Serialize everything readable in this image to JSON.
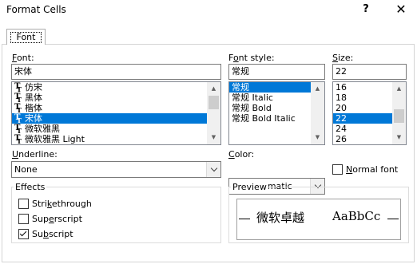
{
  "window": {
    "title": "Format Cells",
    "help_glyph": "?",
    "close_glyph": "✕"
  },
  "tabs": [
    {
      "label": "Font"
    }
  ],
  "font": {
    "label_prefix": "",
    "label_accel": "F",
    "label_rest": "ont:",
    "value": "宋体",
    "items": [
      "仿宋",
      "黑体",
      "楷体",
      "宋体",
      "微软雅黑",
      "微软雅黑 Light"
    ],
    "selected_index": 3
  },
  "font_style": {
    "label_prefix": "F",
    "label_accel": "o",
    "label_rest": "nt style:",
    "value": "常规",
    "items": [
      "常规",
      "常规 Italic",
      "常规 Bold",
      "常规 Bold Italic"
    ],
    "selected_index": 0
  },
  "size": {
    "label_prefix": "",
    "label_accel": "S",
    "label_rest": "ize:",
    "value": "22",
    "items": [
      "16",
      "18",
      "20",
      "22",
      "24",
      "26"
    ],
    "selected_index": 3
  },
  "underline": {
    "label_prefix": "",
    "label_accel": "U",
    "label_rest": "nderline:",
    "value": "None"
  },
  "color": {
    "label_prefix": "",
    "label_accel": "C",
    "label_rest": "olor:",
    "value": "Automatic"
  },
  "normal_font": {
    "label_prefix": "",
    "label_accel": "N",
    "label_rest": "ormal font",
    "checked": false
  },
  "effects": {
    "title": "Effects",
    "strikethrough": {
      "label_prefix": "Stri",
      "label_accel": "k",
      "label_rest": "ethrough",
      "checked": false
    },
    "superscript": {
      "label_prefix": "Sup",
      "label_accel": "e",
      "label_rest": "rscript",
      "checked": false
    },
    "subscript": {
      "label_prefix": "Su",
      "label_accel": "b",
      "label_rest": "script",
      "checked": true
    }
  },
  "preview": {
    "title": "Preview",
    "sample_cjk": "微软卓越",
    "sample_latin": "AaBbCc"
  },
  "colors": {
    "selection": "#0078d7",
    "border": "#7a7a7a",
    "scrollbar_track": "#f0f0f0",
    "scrollbar_thumb": "#cdcdcd"
  }
}
